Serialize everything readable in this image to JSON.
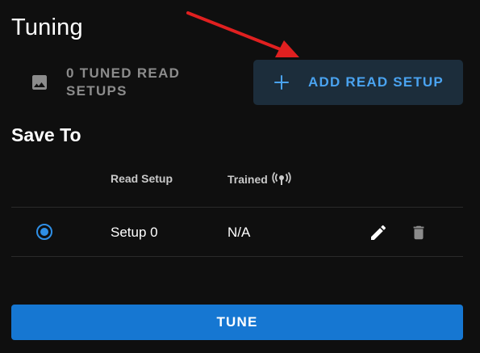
{
  "page": {
    "title": "Tuning",
    "save_to_label": "Save To"
  },
  "tuned_status": {
    "text": "0 TUNED READ SETUPS",
    "icon": "image-icon"
  },
  "add_button": {
    "label": "ADD READ SETUP",
    "icon": "plus-icon"
  },
  "table": {
    "columns": [
      "Read Setup",
      "Trained"
    ],
    "trained_icon": "sensor-icon",
    "rows": [
      {
        "selected": true,
        "name": "Setup 0",
        "trained": "N/A"
      }
    ]
  },
  "tune_button": {
    "label": "TUNE"
  },
  "colors": {
    "background": "#0f0f0f",
    "accent": "#4aa3f0",
    "primary_button": "#1677d2",
    "annotation_arrow": "#e02020"
  }
}
